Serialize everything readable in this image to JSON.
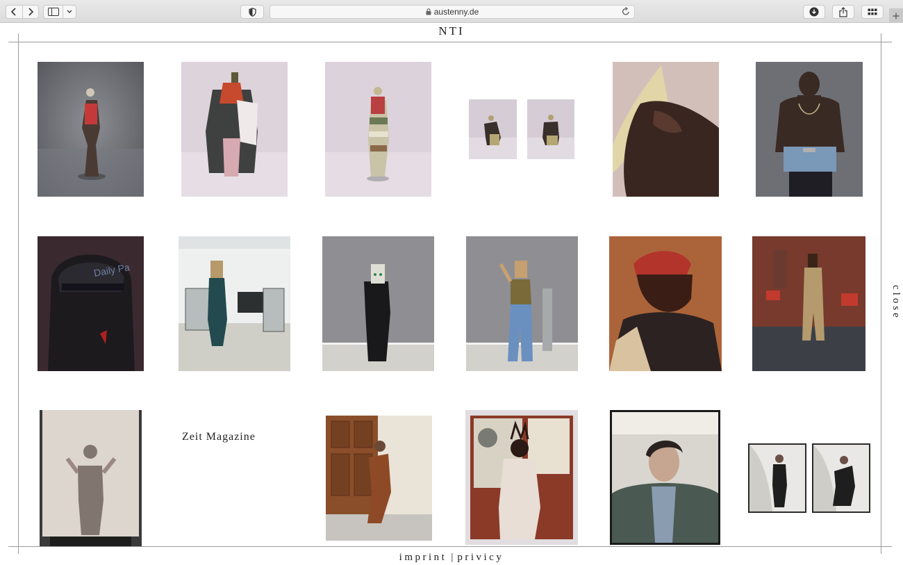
{
  "browser": {
    "url": "austenny.de",
    "icons": {
      "back": "chevron-left-icon",
      "forward": "chevron-right-icon",
      "sidebar": "sidebar-icon",
      "privacy": "shield-icon",
      "lock": "lock-icon",
      "reload": "reload-icon",
      "download": "download-icon",
      "share": "share-icon",
      "tabs": "tab-overview-icon",
      "new_tab": "plus-icon"
    }
  },
  "site": {
    "logo": "NTI",
    "close_label": "close",
    "caption": "Zeit Magazine",
    "footer": {
      "imprint": "imprint",
      "separator": "|",
      "privacy": "privicy"
    }
  },
  "gallery": {
    "rows": 3,
    "photo_count": 20,
    "palette": {
      "studio_grey": "#6b6d72",
      "studio_pink": "#d8cdd6",
      "dark_plum": "#3a2a30",
      "warm_red": "#7a2e22",
      "office_white": "#e7e9e8",
      "concrete": "#8e8e90"
    }
  }
}
